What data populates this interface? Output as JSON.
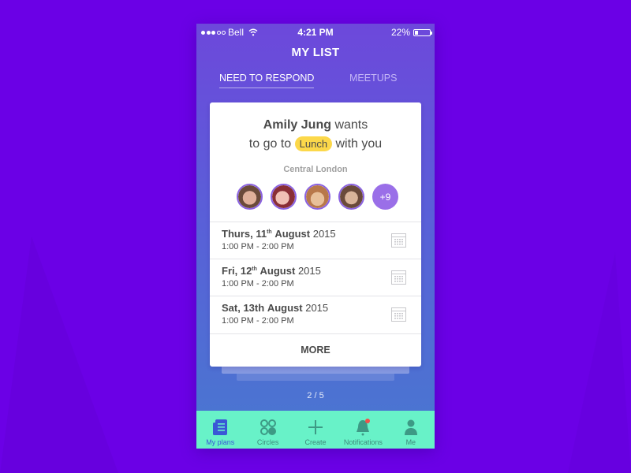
{
  "status_bar": {
    "carrier": "Bell",
    "signal_bars_filled": 3,
    "signal_bars_total": 5,
    "time": "4:21 PM",
    "battery_percent_label": "22%",
    "battery_level": 0.22
  },
  "header": {
    "title": "MY LIST"
  },
  "tabs": [
    {
      "label": "NEED TO RESPOND",
      "active": true
    },
    {
      "label": "MEETUPS",
      "active": false
    }
  ],
  "card": {
    "sender": "Amily Jung",
    "wants": "wants",
    "to_go_to": "to go to",
    "activity": "Lunch",
    "with_you": "with you",
    "location": "Central London",
    "participants": [
      {
        "icon": "avatar-photo-1"
      },
      {
        "icon": "avatar-photo-2"
      },
      {
        "icon": "avatar-photo-3"
      },
      {
        "icon": "avatar-photo-4"
      }
    ],
    "more_participants": "+9",
    "dates": [
      {
        "day": "Thurs, 11",
        "suffix": "th",
        "month": "August",
        "year": "2015",
        "time": "1:00 PM - 2:00 PM"
      },
      {
        "day": "Fri, 12",
        "suffix": "th",
        "month": "August",
        "year": "2015",
        "time": "1:00 PM - 2:00 PM"
      },
      {
        "day": "Sat, 13th",
        "suffix": "",
        "month": "August",
        "year": "2015",
        "time": "1:00 PM - 2:00 PM"
      }
    ],
    "more_label": "MORE"
  },
  "pager": "2 / 5",
  "tab_bar": [
    {
      "label": "My plans",
      "icon": "document-list-icon",
      "active": true
    },
    {
      "label": "Circles",
      "icon": "circles-icon",
      "active": false
    },
    {
      "label": "Create",
      "icon": "plus-icon",
      "active": false
    },
    {
      "label": "Notifications",
      "icon": "bell-icon",
      "active": false,
      "badge": true
    },
    {
      "label": "Me",
      "icon": "person-icon",
      "active": false
    }
  ],
  "colors": {
    "background": "#6b00e6",
    "accent_purple": "#8a62e0",
    "tab_bar": "#68f2c8",
    "pill_yellow": "#fcd84a",
    "notification_badge": "#f0504a"
  }
}
